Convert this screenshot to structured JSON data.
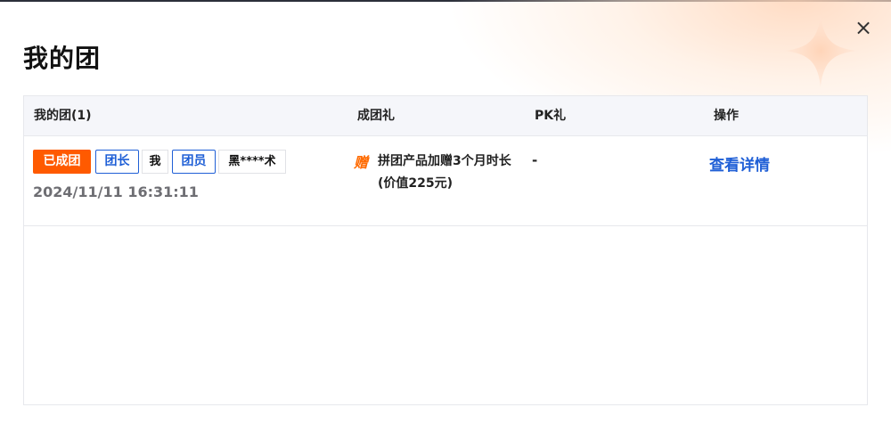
{
  "modal": {
    "title": "我的团",
    "close_icon": "close-icon"
  },
  "table": {
    "headers": {
      "group": "我的团(1)",
      "gift": "成团礼",
      "pk": "PK礼",
      "action": "操作"
    },
    "rows": [
      {
        "status": "已成团",
        "leader_label": "团长",
        "leader_name": "我",
        "member_label": "团员",
        "member_name": "黑****术",
        "time": "2024/11/11 16:31:11",
        "gift_icon_text": "赠",
        "gift_text": "拼团产品加赠3个月时长 (价值225元)",
        "pk": "-",
        "action_label": "查看详情"
      }
    ]
  },
  "colors": {
    "accent_orange": "#ff5a00",
    "link_blue": "#1f5fd6"
  }
}
